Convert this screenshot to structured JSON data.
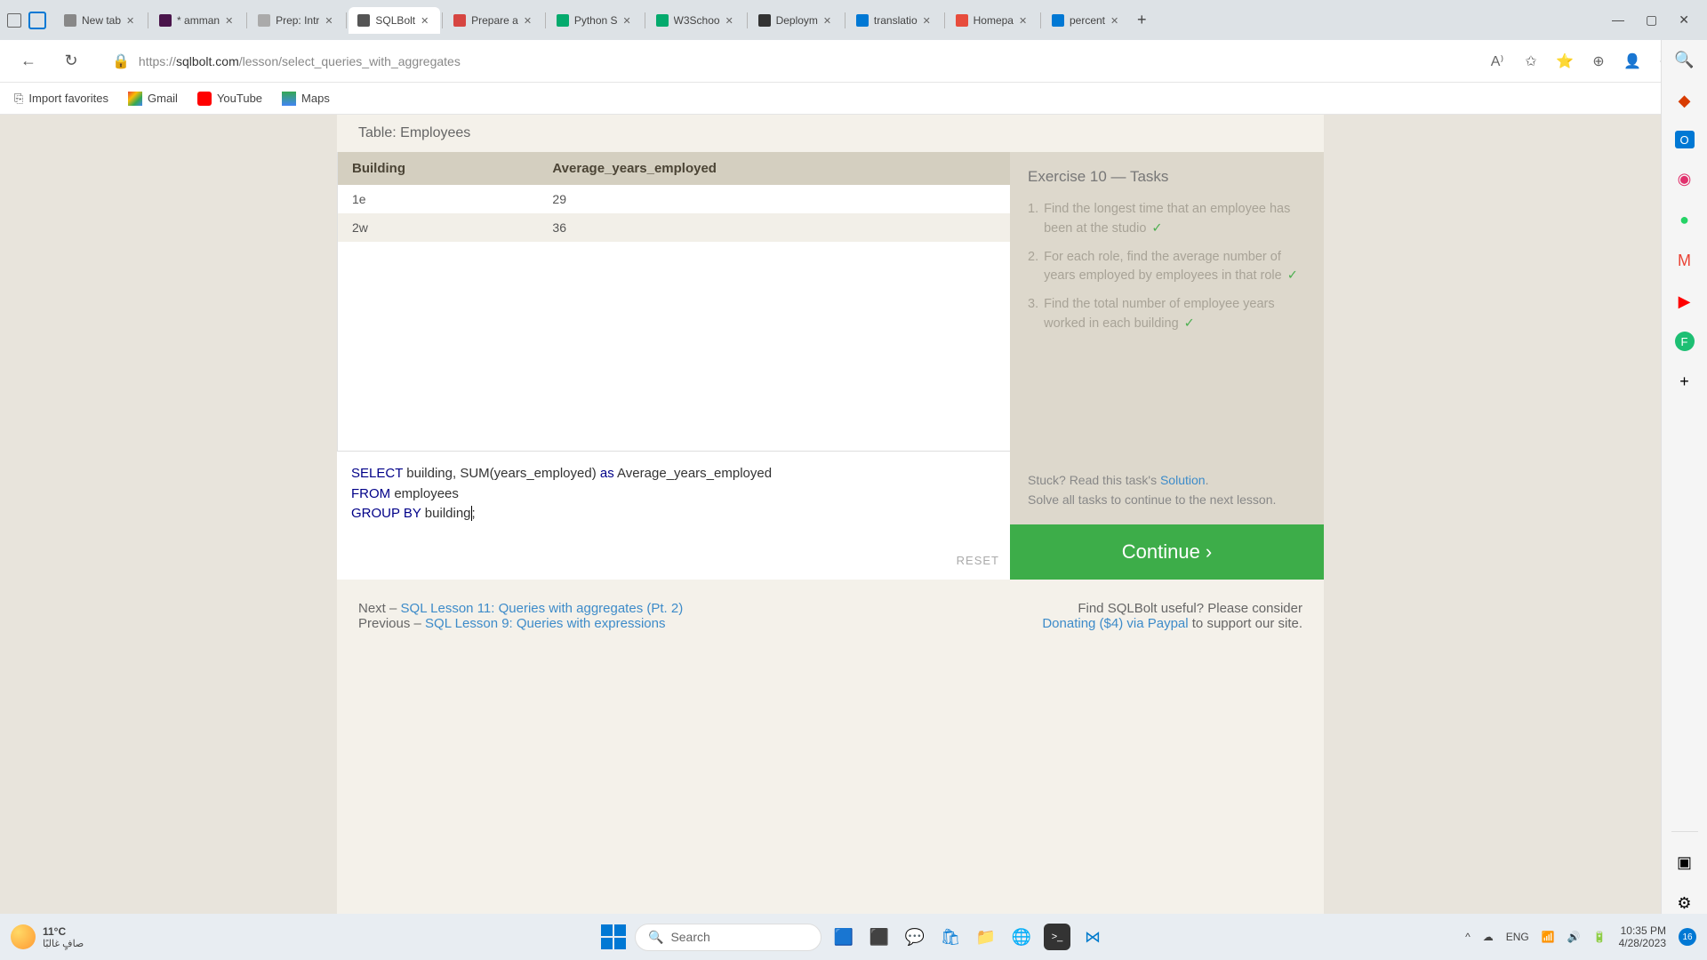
{
  "browser": {
    "tabs": [
      {
        "label": "New tab",
        "icon": "page"
      },
      {
        "label": "* amman",
        "icon": "slack"
      },
      {
        "label": "Prep: Intr",
        "icon": "gear"
      },
      {
        "label": "SQLBolt",
        "icon": "db",
        "active": true
      },
      {
        "label": "Prepare a",
        "icon": "ninja"
      },
      {
        "label": "Python S",
        "icon": "w3"
      },
      {
        "label": "W3Schoo",
        "icon": "w3"
      },
      {
        "label": "Deploym",
        "icon": "github"
      },
      {
        "label": "translatio",
        "icon": "search"
      },
      {
        "label": "Homepa",
        "icon": "dash"
      },
      {
        "label": "percent",
        "icon": "search"
      }
    ],
    "url_prefix": "https://",
    "url_domain": "sqlbolt.com",
    "url_path": "/lesson/select_queries_with_aggregates",
    "favorites": [
      "Import favorites",
      "Gmail",
      "YouTube",
      "Maps"
    ]
  },
  "page": {
    "table_title": "Table: Employees",
    "columns": [
      "Building",
      "Average_years_employed"
    ],
    "rows": [
      [
        "1e",
        "29"
      ],
      [
        "2w",
        "36"
      ]
    ],
    "sql_kw_select": "SELECT",
    "sql_t1": " building, ",
    "sql_fn": "SUM",
    "sql_t2": "(years_employed) ",
    "sql_kw_as": "as",
    "sql_t3": " Average_years_employed",
    "sql_kw_from": "FROM",
    "sql_t4": " employees",
    "sql_kw_group": "GROUP BY",
    "sql_t5": " building",
    "sql_semi": ";",
    "reset_label": "RESET",
    "exercise_title": "Exercise 10 — Tasks",
    "tasks": [
      "Find the longest time that an employee has been at the studio",
      "For each role, find the average number of years employed by employees in that role",
      "Find the total number of employee years worked in each building"
    ],
    "stuck_prefix": "Stuck? Read this task's ",
    "stuck_link": "Solution",
    "solve_all": "Solve all tasks to continue to the next lesson.",
    "continue_label": "Continue ›",
    "next_prefix": "Next – ",
    "next_link": "SQL Lesson 11: Queries with aggregates (Pt. 2)",
    "prev_prefix": "Previous – ",
    "prev_link": "SQL Lesson 9: Queries with expressions",
    "useful_text": "Find SQLBolt useful? Please consider",
    "donate_link": "Donating ($4) via Paypal",
    "donate_suffix": " to support our site."
  },
  "taskbar": {
    "temp": "11°C",
    "weather_ar": "صافٍ غالبًا",
    "search_placeholder": "Search",
    "lang": "ENG",
    "time": "10:35 PM",
    "date": "4/28/2023",
    "notif_count": "16"
  }
}
